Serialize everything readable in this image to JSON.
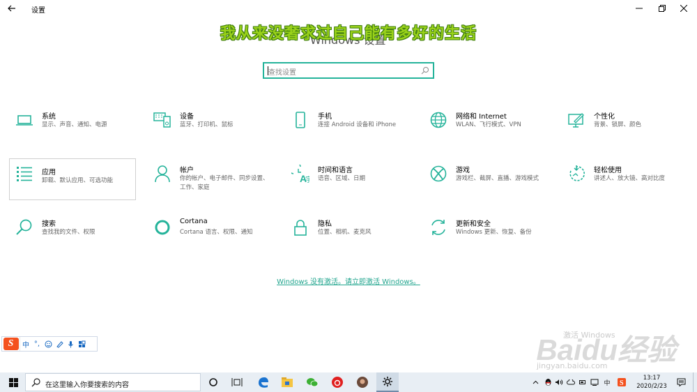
{
  "window": {
    "title": "设置"
  },
  "overlay_title": "我从来没奢求过自己能有多好的生活",
  "header_behind": "Windows 设置",
  "search": {
    "placeholder": "查找设置"
  },
  "categories": [
    {
      "name": "系统",
      "desc": "显示、声音、通知、电源",
      "icon": "laptop-icon"
    },
    {
      "name": "设备",
      "desc": "蓝牙、打印机、鼠标",
      "icon": "devices-icon"
    },
    {
      "name": "手机",
      "desc": "连接 Android 设备和 iPhone",
      "icon": "phone-icon"
    },
    {
      "name": "网络和 Internet",
      "desc": "WLAN、飞行模式、VPN",
      "icon": "globe-icon"
    },
    {
      "name": "个性化",
      "desc": "背景、锁屏、颜色",
      "icon": "personalize-icon"
    },
    {
      "name": "应用",
      "desc": "卸载、默认应用、可选功能",
      "icon": "apps-list-icon"
    },
    {
      "name": "帐户",
      "desc": "你的帐户、电子邮件、同步设置、工作、家庭",
      "icon": "person-icon"
    },
    {
      "name": "时间和语言",
      "desc": "语音、区域、日期",
      "icon": "time-language-icon"
    },
    {
      "name": "游戏",
      "desc": "游戏栏、截屏、直播、游戏模式",
      "icon": "xbox-icon"
    },
    {
      "name": "轻松使用",
      "desc": "讲述人、放大镜、高对比度",
      "icon": "ease-of-access-icon"
    },
    {
      "name": "搜索",
      "desc": "查找我的文件、权限",
      "icon": "search-icon"
    },
    {
      "name": "Cortana",
      "desc": "Cortana 语言、权限、通知",
      "icon": "cortana-icon"
    },
    {
      "name": "隐私",
      "desc": "位置、相机、麦克风",
      "icon": "lock-icon"
    },
    {
      "name": "更新和安全",
      "desc": "Windows 更新、恢复、备份",
      "icon": "update-icon"
    }
  ],
  "activation_link": "Windows 没有激活。请立即激活 Windows。",
  "ime": {
    "mode": "中",
    "punct": "°,"
  },
  "watermark": {
    "brand": "Baidu经验",
    "url": "jingyan.baidu.com",
    "faint": "激活 Windows"
  },
  "taskbar": {
    "search_text": "在这里输入你要搜索的内容",
    "tray_ime": "中",
    "time": "13:17",
    "date": "2020/2/23"
  },
  "colors": {
    "accent": "#24b39a",
    "link": "#21a58e",
    "overlay": "#9ad21a"
  }
}
